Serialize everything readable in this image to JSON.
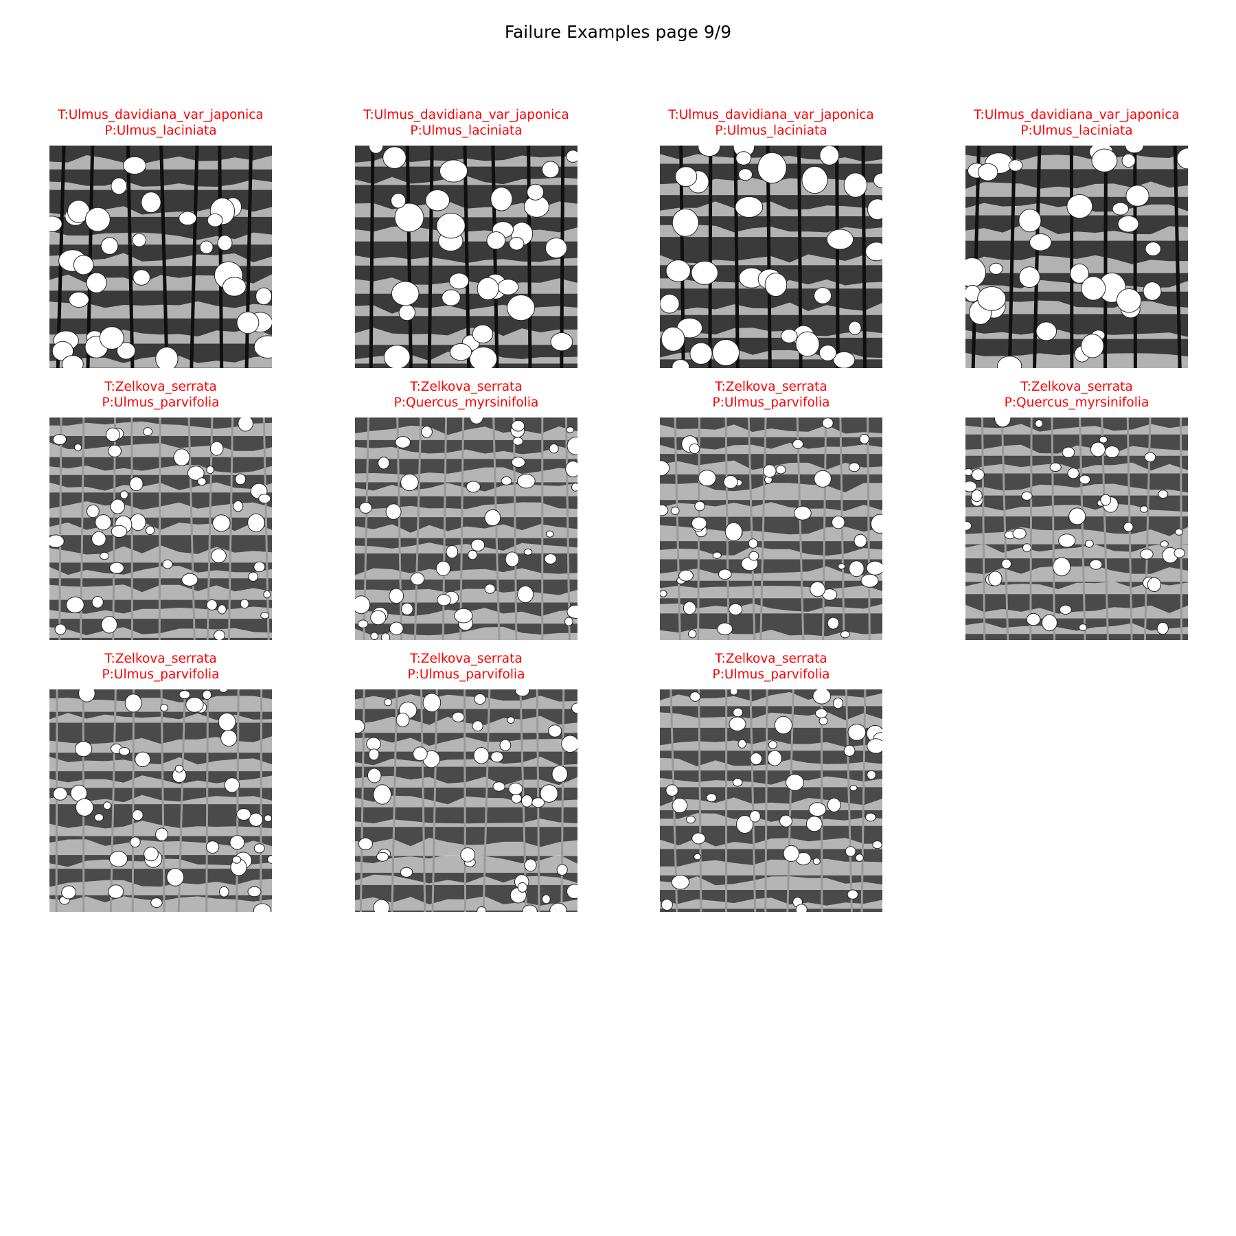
{
  "page": {
    "title": "Failure Examples page 9/9"
  },
  "colors": {
    "label": "#ff0000",
    "title": "#000000"
  },
  "examples": [
    {
      "true_label": "T:Ulmus_davidiana_var_japonica",
      "pred_label": "P:Ulmus_laciniata"
    },
    {
      "true_label": "T:Ulmus_davidiana_var_japonica",
      "pred_label": "P:Ulmus_laciniata"
    },
    {
      "true_label": "T:Ulmus_davidiana_var_japonica",
      "pred_label": "P:Ulmus_laciniata"
    },
    {
      "true_label": "T:Ulmus_davidiana_var_japonica",
      "pred_label": "P:Ulmus_laciniata"
    },
    {
      "true_label": "T:Zelkova_serrata",
      "pred_label": "P:Ulmus_parvifolia"
    },
    {
      "true_label": "T:Zelkova_serrata",
      "pred_label": "P:Quercus_myrsinifolia"
    },
    {
      "true_label": "T:Zelkova_serrata",
      "pred_label": "P:Ulmus_parvifolia"
    },
    {
      "true_label": "T:Zelkova_serrata",
      "pred_label": "P:Quercus_myrsinifolia"
    },
    {
      "true_label": "T:Zelkova_serrata",
      "pred_label": "P:Ulmus_parvifolia"
    },
    {
      "true_label": "T:Zelkova_serrata",
      "pred_label": "P:Ulmus_parvifolia"
    },
    {
      "true_label": "T:Zelkova_serrata",
      "pred_label": "P:Ulmus_parvifolia"
    }
  ]
}
